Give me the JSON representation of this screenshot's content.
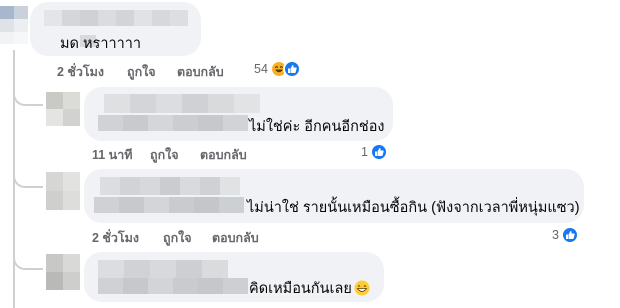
{
  "comments": [
    {
      "text": "มด  หราาาาา",
      "time": "2 ชั่วโมง",
      "like_label": "ถูกใจ",
      "reply_label": "ตอบกลับ",
      "reaction_count": "54",
      "reactions": [
        "haha-icon",
        "like-icon"
      ]
    },
    {
      "text": "ไม่ใช่ค่ะ อีกคนอีกช่อง",
      "time": "11 นาที",
      "like_label": "ถูกใจ",
      "reply_label": "ตอบกลับ",
      "reaction_count": "1",
      "reactions": [
        "like-icon"
      ]
    },
    {
      "text": "ไม่น่าใช่ รายนั้นเหมือนซื้อกิน (ฟังจากเวลาพี่หนุ่มแซว)",
      "time": "2 ชั่วโมง",
      "like_label": "ถูกใจ",
      "reply_label": "ตอบกลับ",
      "reaction_count": "3",
      "reactions": [
        "like-icon"
      ]
    },
    {
      "text": "คิดเหมือนกันเลย",
      "inline_emoji": "grinning-face-icon"
    }
  ],
  "colors": {
    "bubble_bg": "#f0f2f5",
    "meta_text": "#65676b",
    "like_blue": "#1877f2",
    "haha_yellow": "#f7b125",
    "thread_line": "#ced0d4"
  }
}
